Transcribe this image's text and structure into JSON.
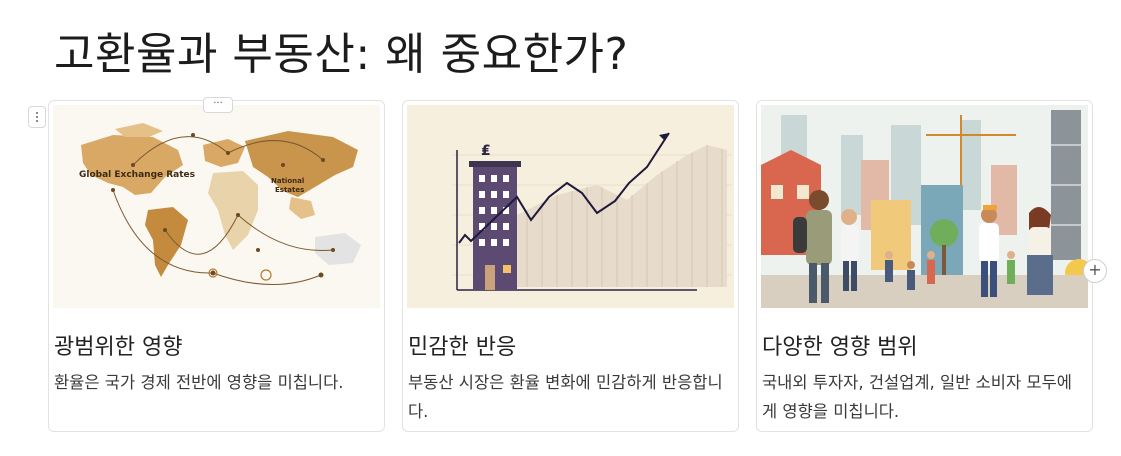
{
  "page": {
    "title": "고환율과 부동산: 왜 중요한가?"
  },
  "controls": {
    "more_label": "···",
    "add_label": "+"
  },
  "cards": [
    {
      "title": "광범위한 영향",
      "desc": "환율은 국가 경제 전반에 영향을 미칩니다.",
      "image_text": {
        "map_title": "Global Exchange Rates",
        "center_label_1": "National",
        "center_label_2": "Estates"
      }
    },
    {
      "title": "민감한 반응",
      "desc": "부동산 시장은 환율 변화에 민감하게 반응합니다.",
      "image_text": {
        "currency_symbol": "₤"
      }
    },
    {
      "title": "다양한 영향 범위",
      "desc": "국내외 투자자, 건설업계, 일반 소비자 모두에게 영향을 미칩니다."
    }
  ]
}
